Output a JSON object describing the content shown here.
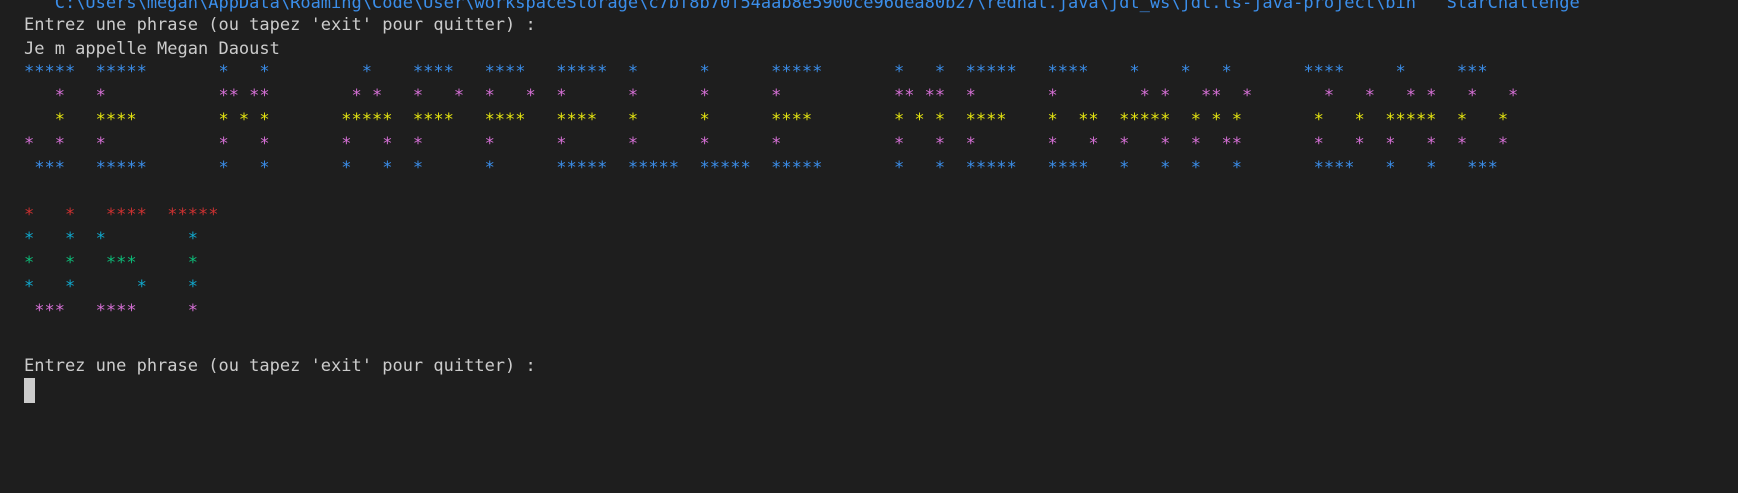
{
  "terminal": {
    "path": "   C:\\Users\\megan\\AppData\\Roaming\\Code\\User\\workspaceStorage\\c7bf8b70f54aab8e5900ce96dea80b27\\redhat.java\\jdt_ws\\jdt.ls-java-project\\bin   StarChallenge",
    "prompt": "Entrez une phrase (ou tapez 'exit' pour quitter) :",
    "input": "Je m appelle Megan Daoust",
    "art1": [
      "*****  *****       *   *         *    ****   ****   *****  *      *      *****       *   *  *****   ****    *    *   *       ****     *     ***",
      "   *   *           ** **        * *   *   *  *   *  *      *      *      *           ** **  *       *        * *   **  *       *   *   * *   *   *",
      "   *   ****        * * *       *****  ****   ****   ****   *      *      ****        * * *  ****    *  **  *****  * * *       *   *  *****  *   *",
      "*  *   *           *   *       *   *  *      *      *      *      *      *           *   *  *       *   *  *   *  *  **       *   *  *   *  *   *",
      " ***   *****       *   *       *   *  *      *      *****  *****  *****  *****       *   *  *****   ****   *   *  *   *       ****   *   *   ***"
    ],
    "art2": [
      "*   *   ****  *****",
      "*   *  *        *",
      "*   *   ***     *",
      "*   *      *    *",
      " ***   ****     *"
    ],
    "prompt2": "Entrez une phrase (ou tapez 'exit' pour quitter) :",
    "colors": {
      "background": "#1e1e1e",
      "text": "#cccccc",
      "blue": "#3b8eea",
      "magenta": "#d670d6",
      "yellow": "#e5e510",
      "red": "#cd3131",
      "cyan": "#11a8cd",
      "green": "#0dbc79"
    }
  }
}
